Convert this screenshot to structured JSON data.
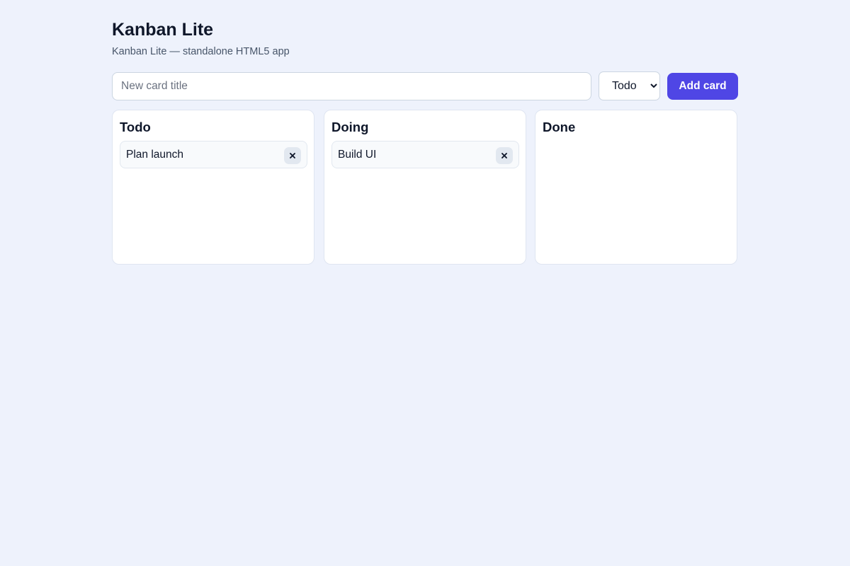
{
  "app": {
    "title": "Kanban Lite",
    "subtitle": "Kanban Lite — standalone HTML5 app"
  },
  "form": {
    "title_input": {
      "value": "",
      "placeholder": "New card title"
    },
    "column_select": {
      "selected": "Todo"
    },
    "add_button": "Add card"
  },
  "columns": [
    {
      "title": "Todo",
      "cards": [
        {
          "title": "Plan launch",
          "delete_icon": "close-icon"
        }
      ]
    },
    {
      "title": "Doing",
      "cards": [
        {
          "title": "Build UI",
          "delete_icon": "close-icon"
        }
      ]
    },
    {
      "title": "Done",
      "cards": []
    }
  ],
  "colors": {
    "background": "#eef2fc",
    "accent": "#4f46e5",
    "card_background": "#f8fafc",
    "text": "#0f172a"
  }
}
